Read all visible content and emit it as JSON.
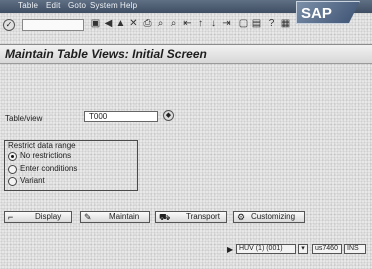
{
  "menu": [
    "Table",
    "Edit",
    "Goto",
    "System",
    "Help"
  ],
  "logo_text": "SAP",
  "toolbar": {
    "ok_glyph": "✓",
    "icons": [
      "save-icon",
      "back-icon",
      "exit-icon",
      "cancel-icon",
      "print-icon",
      "find-icon",
      "find-next-icon",
      "first-page-icon",
      "previous-page-icon",
      "next-page-icon",
      "last-page-icon",
      "new-session-icon",
      "shortcut-icon",
      "help-icon",
      "layout-icon"
    ]
  },
  "page_title": "Maintain Table Views: Initial Screen",
  "table_field": {
    "label": "Table/view",
    "value": "T000"
  },
  "restrict": {
    "title": "Restrict data range",
    "options": [
      {
        "label": "No restrictions",
        "selected": true
      },
      {
        "label": "Enter conditions",
        "selected": false
      },
      {
        "label": "Variant",
        "selected": false
      }
    ]
  },
  "actions": {
    "display": "Display",
    "maintain": "Maintain",
    "transport": "Transport",
    "customizing": "Customizing"
  },
  "status": {
    "system": "HUV (1) (001)",
    "server": "us7460",
    "mode": "INS"
  }
}
